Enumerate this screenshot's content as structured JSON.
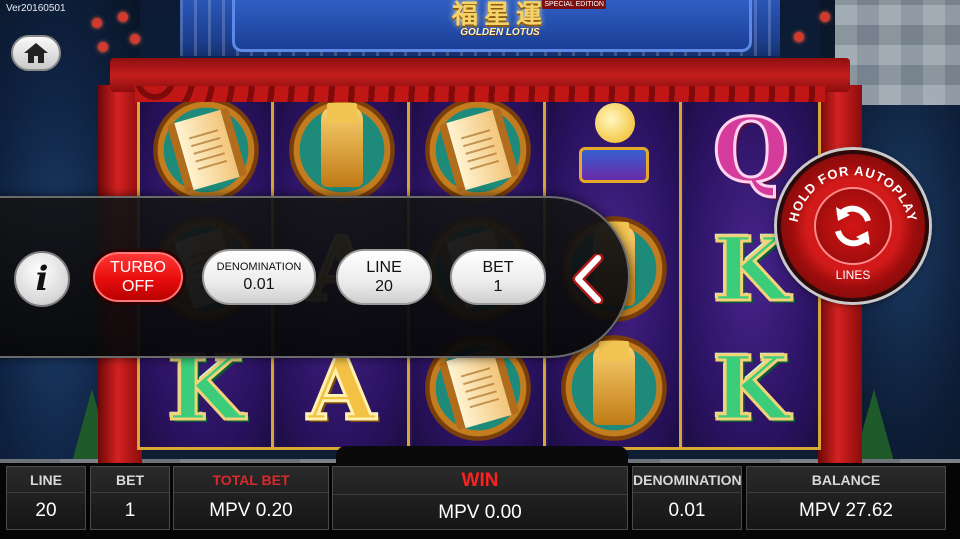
{
  "version_label": "Ver20160501",
  "logo": {
    "han": "福星運",
    "name": "GOLDEN LOTUS",
    "badge": "SPECIAL EDITION"
  },
  "reels": [
    [
      "scroll",
      "scroll",
      "K"
    ],
    [
      "statue",
      "A",
      "A"
    ],
    [
      "scroll",
      "scroll",
      "scroll"
    ],
    [
      "orb",
      "statue",
      "statue"
    ],
    [
      "Q",
      "K",
      "K"
    ]
  ],
  "options_panel": {
    "info_label": "i",
    "turbo": {
      "title": "TURBO",
      "value": "OFF"
    },
    "denomination": {
      "title": "DENOMINATION",
      "value": "0.01"
    },
    "line": {
      "title": "LINE",
      "value": "20"
    },
    "bet": {
      "title": "BET",
      "value": "1"
    }
  },
  "autoplay": {
    "arc_text": "HOLD FOR AUTOPLAY",
    "lines_label": "LINES"
  },
  "status_bar": {
    "line": {
      "label": "LINE",
      "value": "20"
    },
    "bet": {
      "label": "BET",
      "value": "1"
    },
    "total_bet": {
      "label": "TOTAL BET",
      "value": "MPV 0.20"
    },
    "win": {
      "label": "WIN",
      "value": "MPV 0.00"
    },
    "denomination": {
      "label": "DENOMINATION",
      "value": "0.01"
    },
    "balance": {
      "label": "BALANCE",
      "value": "MPV 27.62"
    }
  },
  "colors": {
    "accent_red": "#e80d0d",
    "reel_frame_gold": "#d8a733",
    "reel_bg_purple": "#2c1858"
  },
  "icons": {
    "home": "home-icon",
    "info": "info-icon",
    "collapse": "chevron-left-icon",
    "autoplay": "refresh-icon"
  }
}
